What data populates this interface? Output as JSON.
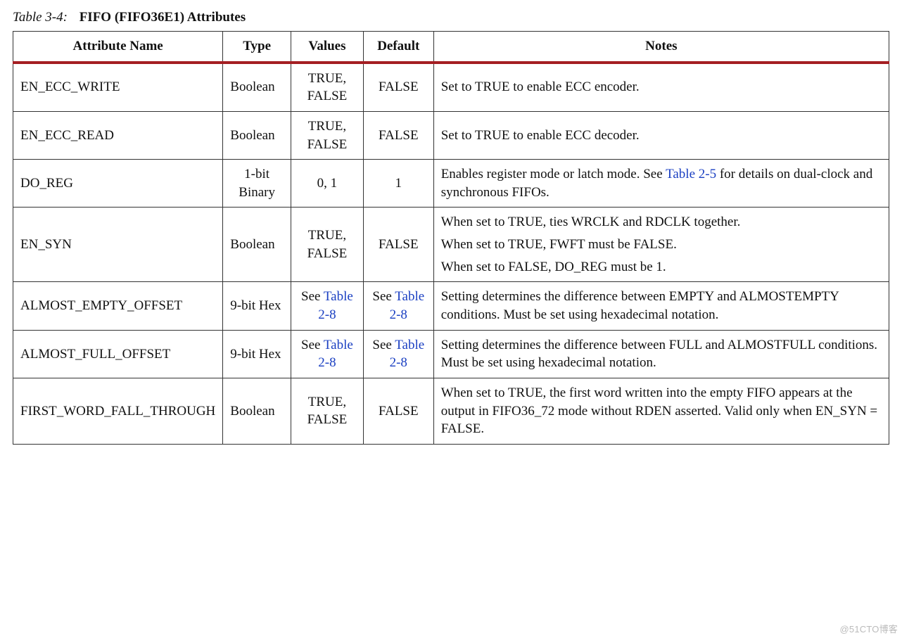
{
  "caption": {
    "lead": "Table 3-4:",
    "title": "FIFO (FIFO36E1) Attributes"
  },
  "headers": {
    "attr": "Attribute Name",
    "type": "Type",
    "values": "Values",
    "default": "Default",
    "notes": "Notes"
  },
  "rows": {
    "r0": {
      "attr": "EN_ECC_WRITE",
      "type": "Boolean",
      "values": "TRUE, FALSE",
      "default": "FALSE",
      "notes1": "Set to TRUE to enable ECC encoder."
    },
    "r1": {
      "attr": "EN_ECC_READ",
      "type": "Boolean",
      "values": "TRUE, FALSE",
      "default": "FALSE",
      "notes1": "Set to TRUE to enable ECC decoder."
    },
    "r2": {
      "attr": "DO_REG",
      "type": "1-bit Binary",
      "values": "0, 1",
      "default": "1",
      "notes_a": "Enables register mode or latch mode. See ",
      "notes_link": "Table 2-5",
      "notes_b": " for details on dual-clock and synchronous FIFOs."
    },
    "r3": {
      "attr": "EN_SYN",
      "type": "Boolean",
      "values": "TRUE, FALSE",
      "default": "FALSE",
      "notes1": "When set to TRUE, ties WRCLK and RDCLK together.",
      "notes2": "When set to TRUE, FWFT must be FALSE.",
      "notes3": "When set to FALSE, DO_REG must be 1."
    },
    "r4": {
      "attr": "ALMOST_EMPTY_OFFSET",
      "type": "9-bit Hex",
      "values_a": "See ",
      "values_link": "Table 2-8",
      "default_a": "See ",
      "default_link": "Table 2-8",
      "notes1": "Setting determines the difference between EMPTY and ALMOSTEMPTY conditions. Must be set using hexadecimal notation."
    },
    "r5": {
      "attr": "ALMOST_FULL_OFFSET",
      "type": "9-bit Hex",
      "values_a": "See ",
      "values_link": "Table 2-8",
      "default_a": "See ",
      "default_link": "Table 2-8",
      "notes1": "Setting determines the difference between FULL and ALMOSTFULL conditions. Must be set using hexadecimal notation."
    },
    "r6": {
      "attr": "FIRST_WORD_FALL_THROUGH",
      "type": "Boolean",
      "values": "TRUE, FALSE",
      "default": "FALSE",
      "notes1": "When set to TRUE, the first word written into the empty FIFO appears at the output in FIFO36_72 mode without RDEN asserted. Valid only when EN_SYN = FALSE."
    }
  },
  "watermark": "@51CTO博客"
}
